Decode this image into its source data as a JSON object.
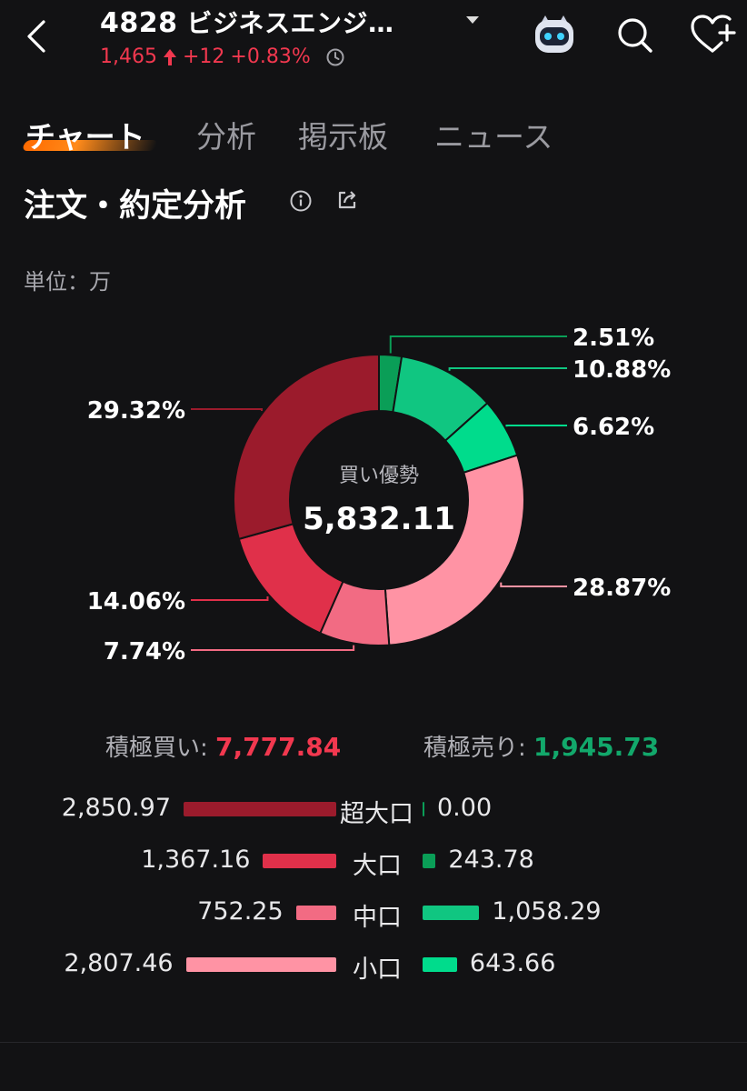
{
  "header": {
    "code": "4828",
    "name": "ビジネスエンジ…",
    "price": "1,465",
    "change": "+12",
    "change_pct": "+0.83%",
    "icons": [
      "back-icon",
      "dropdown-icon",
      "robot-icon",
      "search-icon",
      "heart-plus-icon"
    ]
  },
  "tabs": [
    "チャート",
    "分析",
    "掲示板",
    "ニュース"
  ],
  "section": {
    "title": "注文・約定分析",
    "unit": "単位：万"
  },
  "chart_data": {
    "type": "pie",
    "style": "donut",
    "center_label": "買い優勢",
    "center_value": "5,832.11",
    "slices": [
      {
        "label": "2.51%",
        "value": 2.51,
        "color": "#0a9e57"
      },
      {
        "label": "10.88%",
        "value": 10.88,
        "color": "#10c681"
      },
      {
        "label": "6.62%",
        "value": 6.62,
        "color": "#00dc8c"
      },
      {
        "label": "28.87%",
        "value": 28.87,
        "color": "#ff93a4"
      },
      {
        "label": "7.74%",
        "value": 7.74,
        "color": "#f26b83"
      },
      {
        "label": "14.06%",
        "value": 14.06,
        "color": "#e0304a"
      },
      {
        "label": "29.32%",
        "value": 29.32,
        "color": "#9b1b2c"
      }
    ]
  },
  "totals": {
    "buy_label": "積極買い:",
    "buy_value": "7,777.84",
    "sell_label": "積極売り:",
    "sell_value": "1,945.73"
  },
  "breakdown": [
    {
      "label": "超大口",
      "buy": "2,850.97",
      "sell": "0.00",
      "buy_num": 2850.97,
      "sell_num": 0.0,
      "buy_color": "#9b1b2c",
      "sell_color": "#0a9e57"
    },
    {
      "label": "大口",
      "buy": "1,367.16",
      "sell": "243.78",
      "buy_num": 1367.16,
      "sell_num": 243.78,
      "buy_color": "#e0304a",
      "sell_color": "#0a9e57"
    },
    {
      "label": "中口",
      "buy": "752.25",
      "sell": "1,058.29",
      "buy_num": 752.25,
      "sell_num": 1058.29,
      "buy_color": "#f26b83",
      "sell_color": "#10c681"
    },
    {
      "label": "小口",
      "buy": "2,807.46",
      "sell": "643.66",
      "buy_num": 2807.46,
      "sell_num": 643.66,
      "buy_color": "#ff93a4",
      "sell_color": "#00dc8c"
    }
  ]
}
